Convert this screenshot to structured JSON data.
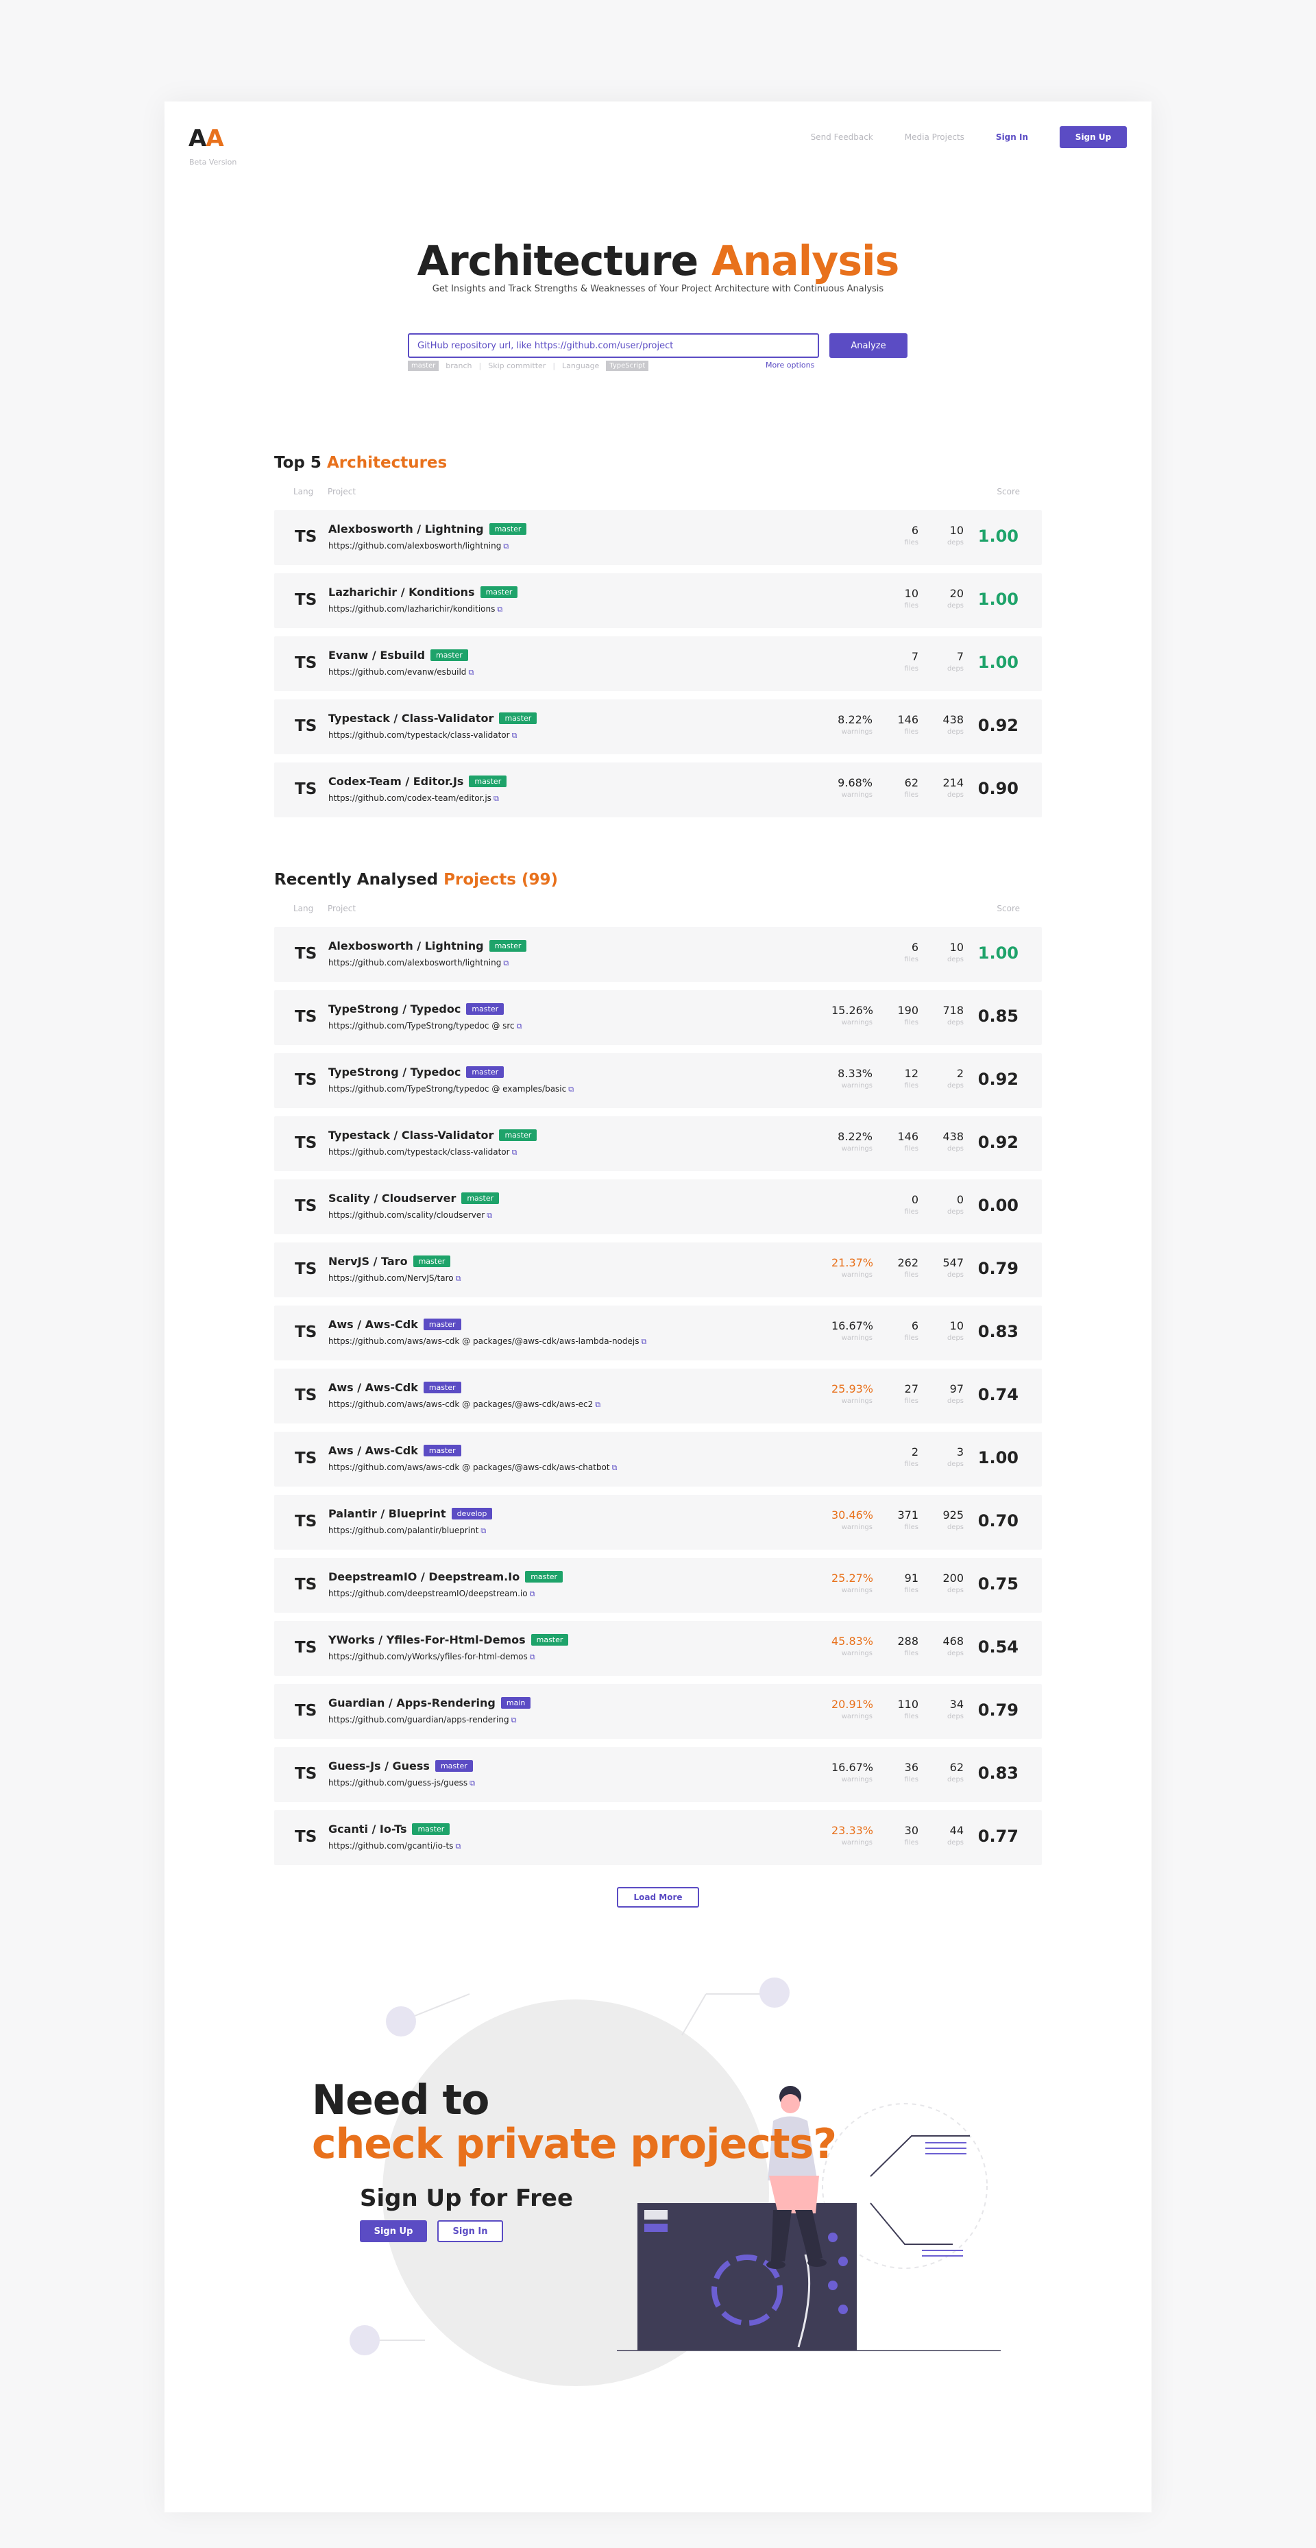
{
  "header": {
    "logo": {
      "letter1": "A",
      "letter2": "A"
    },
    "beta": "Beta Version",
    "nav": {
      "feedback": "Send Feedback",
      "media": "Media Projects",
      "signin": "Sign In",
      "signup": "Sign Up"
    }
  },
  "hero": {
    "title_part1": "Architecture",
    "title_part2": "Analysis",
    "subtitle": "Get Insights and Track Strengths & Weaknesses of Your Project Architecture with Continuous Analysis",
    "search_placeholder": "GitHub repository url, like https://github.com/user/project",
    "analyze": "Analyze",
    "options": {
      "master": "master",
      "branch": "branch",
      "skip": "Skip committer",
      "language": "Language",
      "typescript": "TypeScript"
    },
    "more_options": "More options"
  },
  "columns": {
    "lang": "Lang",
    "project": "Project",
    "score": "Score",
    "warnings": "warnings",
    "files": "files",
    "deps": "deps",
    "ext_icon": "external-link-icon"
  },
  "top5": {
    "title_part1": "Top 5",
    "title_part2": "Architectures",
    "rows": [
      {
        "lang": "TS",
        "name": "Alexbosworth / Lightning",
        "branch": "master",
        "branch_color": "green",
        "url": "https://github.com/alexbosworth/lightning",
        "warnings": "",
        "warn_orange": false,
        "files": "6",
        "deps": "10",
        "score": "1.00",
        "score_green": true
      },
      {
        "lang": "TS",
        "name": "Lazharichir / Konditions",
        "branch": "master",
        "branch_color": "green",
        "url": "https://github.com/lazharichir/konditions",
        "warnings": "",
        "warn_orange": false,
        "files": "10",
        "deps": "20",
        "score": "1.00",
        "score_green": true
      },
      {
        "lang": "TS",
        "name": "Evanw / Esbuild",
        "branch": "master",
        "branch_color": "green",
        "url": "https://github.com/evanw/esbuild",
        "warnings": "",
        "warn_orange": false,
        "files": "7",
        "deps": "7",
        "score": "1.00",
        "score_green": true
      },
      {
        "lang": "TS",
        "name": "Typestack / Class-Validator",
        "branch": "master",
        "branch_color": "green",
        "url": "https://github.com/typestack/class-validator",
        "warnings": "8.22%",
        "warn_orange": false,
        "files": "146",
        "deps": "438",
        "score": "0.92",
        "score_green": false
      },
      {
        "lang": "TS",
        "name": "Codex-Team / Editor.Js",
        "branch": "master",
        "branch_color": "green",
        "url": "https://github.com/codex-team/editor.js",
        "warnings": "9.68%",
        "warn_orange": false,
        "files": "62",
        "deps": "214",
        "score": "0.90",
        "score_green": false
      }
    ]
  },
  "recent": {
    "title_part1": "Recently Analysed",
    "title_part2": "Projects (99)",
    "rows": [
      {
        "lang": "TS",
        "name": "Alexbosworth / Lightning",
        "branch": "master",
        "branch_color": "green",
        "url": "https://github.com/alexbosworth/lightning",
        "warnings": "",
        "warn_orange": false,
        "files": "6",
        "deps": "10",
        "score": "1.00",
        "score_green": true
      },
      {
        "lang": "TS",
        "name": "TypeStrong / Typedoc",
        "branch": "master",
        "branch_color": "purple",
        "url": "https://github.com/TypeStrong/typedoc  @ src",
        "warnings": "15.26%",
        "warn_orange": false,
        "files": "190",
        "deps": "718",
        "score": "0.85",
        "score_green": false
      },
      {
        "lang": "TS",
        "name": "TypeStrong / Typedoc",
        "branch": "master",
        "branch_color": "purple",
        "url": "https://github.com/TypeStrong/typedoc  @ examples/basic",
        "warnings": "8.33%",
        "warn_orange": false,
        "files": "12",
        "deps": "2",
        "score": "0.92",
        "score_green": false
      },
      {
        "lang": "TS",
        "name": "Typestack / Class-Validator",
        "branch": "master",
        "branch_color": "green",
        "url": "https://github.com/typestack/class-validator",
        "warnings": "8.22%",
        "warn_orange": false,
        "files": "146",
        "deps": "438",
        "score": "0.92",
        "score_green": false
      },
      {
        "lang": "TS",
        "name": "Scality / Cloudserver",
        "branch": "master",
        "branch_color": "green",
        "url": "https://github.com/scality/cloudserver",
        "warnings": "",
        "warn_orange": false,
        "files": "0",
        "deps": "0",
        "score": "0.00",
        "score_green": false
      },
      {
        "lang": "TS",
        "name": "NervJS / Taro",
        "branch": "master",
        "branch_color": "green",
        "url": "https://github.com/NervJS/taro",
        "warnings": "21.37%",
        "warn_orange": true,
        "files": "262",
        "deps": "547",
        "score": "0.79",
        "score_green": false
      },
      {
        "lang": "TS",
        "name": "Aws / Aws-Cdk",
        "branch": "master",
        "branch_color": "purple",
        "url": "https://github.com/aws/aws-cdk  @ packages/@aws-cdk/aws-lambda-nodejs",
        "warnings": "16.67%",
        "warn_orange": false,
        "files": "6",
        "deps": "10",
        "score": "0.83",
        "score_green": false
      },
      {
        "lang": "TS",
        "name": "Aws / Aws-Cdk",
        "branch": "master",
        "branch_color": "purple",
        "url": "https://github.com/aws/aws-cdk  @ packages/@aws-cdk/aws-ec2",
        "warnings": "25.93%",
        "warn_orange": true,
        "files": "27",
        "deps": "97",
        "score": "0.74",
        "score_green": false
      },
      {
        "lang": "TS",
        "name": "Aws / Aws-Cdk",
        "branch": "master",
        "branch_color": "purple",
        "url": "https://github.com/aws/aws-cdk  @ packages/@aws-cdk/aws-chatbot",
        "warnings": "",
        "warn_orange": false,
        "files": "2",
        "deps": "3",
        "score": "1.00",
        "score_green": false
      },
      {
        "lang": "TS",
        "name": "Palantir / Blueprint",
        "branch": "develop",
        "branch_color": "purple",
        "url": "https://github.com/palantir/blueprint",
        "warnings": "30.46%",
        "warn_orange": true,
        "files": "371",
        "deps": "925",
        "score": "0.70",
        "score_green": false
      },
      {
        "lang": "TS",
        "name": "DeepstreamIO / Deepstream.Io",
        "branch": "master",
        "branch_color": "green",
        "url": "https://github.com/deepstreamIO/deepstream.io",
        "warnings": "25.27%",
        "warn_orange": true,
        "files": "91",
        "deps": "200",
        "score": "0.75",
        "score_green": false
      },
      {
        "lang": "TS",
        "name": "YWorks / Yfiles-For-Html-Demos",
        "branch": "master",
        "branch_color": "green",
        "url": "https://github.com/yWorks/yfiles-for-html-demos",
        "warnings": "45.83%",
        "warn_orange": true,
        "files": "288",
        "deps": "468",
        "score": "0.54",
        "score_green": false
      },
      {
        "lang": "TS",
        "name": "Guardian / Apps-Rendering",
        "branch": "main",
        "branch_color": "purple",
        "url": "https://github.com/guardian/apps-rendering",
        "warnings": "20.91%",
        "warn_orange": true,
        "files": "110",
        "deps": "34",
        "score": "0.79",
        "score_green": false
      },
      {
        "lang": "TS",
        "name": "Guess-Js / Guess",
        "branch": "master",
        "branch_color": "purple",
        "url": "https://github.com/guess-js/guess",
        "warnings": "16.67%",
        "warn_orange": false,
        "files": "36",
        "deps": "62",
        "score": "0.83",
        "score_green": false
      },
      {
        "lang": "TS",
        "name": "Gcanti / Io-Ts",
        "branch": "master",
        "branch_color": "green",
        "url": "https://github.com/gcanti/io-ts",
        "warnings": "23.33%",
        "warn_orange": true,
        "files": "30",
        "deps": "44",
        "score": "0.77",
        "score_green": false
      }
    ]
  },
  "load_more": "Load More",
  "cta": {
    "line1": "Need to",
    "line2": "check private projects?",
    "signup_free": "Sign Up for Free",
    "signup": "Sign Up",
    "signin": "Sign In",
    "illustration": "person-sitting-on-dashboard-illustration"
  },
  "colors": {
    "accent_orange": "#e8711c",
    "brand_purple": "#5b4cc4",
    "score_green": "#1ea36a"
  }
}
